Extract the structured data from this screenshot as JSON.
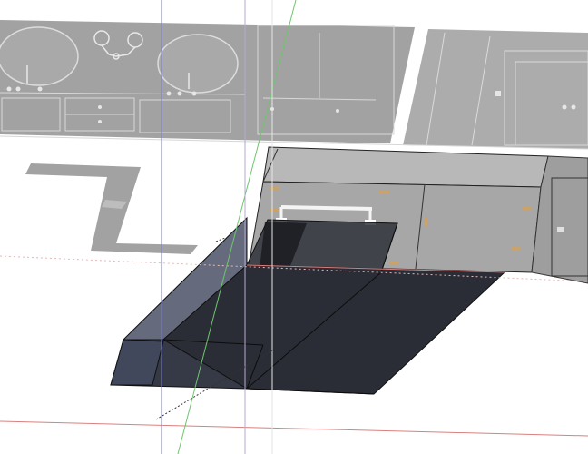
{
  "app": {
    "view": "3d-modeling-viewport"
  },
  "colors": {
    "background": "#ffffff",
    "wall_elevation_fill": "#9a9a9a",
    "wall_elevation_line": "#d8d8d8",
    "cabinet_fill": "#a7a7a7",
    "shadow_fill": "#a2a2a2",
    "solid_dark": "#2b2d36",
    "solid_dark_mid": "#363946",
    "solid_light": "#50566a",
    "edge_line": "#111111",
    "axis_red": "#d98080",
    "axis_green": "#6cc66c",
    "axis_blue": "#7a7ad8",
    "guide_purple": "#b5aad0"
  },
  "scene": {
    "objects": [
      {
        "name": "vanity-elevation",
        "icon": "sink-icon"
      },
      {
        "name": "door-elevation",
        "icon": "door-icon"
      },
      {
        "name": "cabinet-3d",
        "icon": "cabinet-icon"
      },
      {
        "name": "floor-shadow",
        "icon": "shadow-icon"
      },
      {
        "name": "extruded-solid",
        "icon": "solid-icon"
      },
      {
        "name": "towel-bar",
        "icon": "bar-icon"
      }
    ],
    "axes": [
      "red-axis",
      "green-axis",
      "blue-axis"
    ]
  }
}
